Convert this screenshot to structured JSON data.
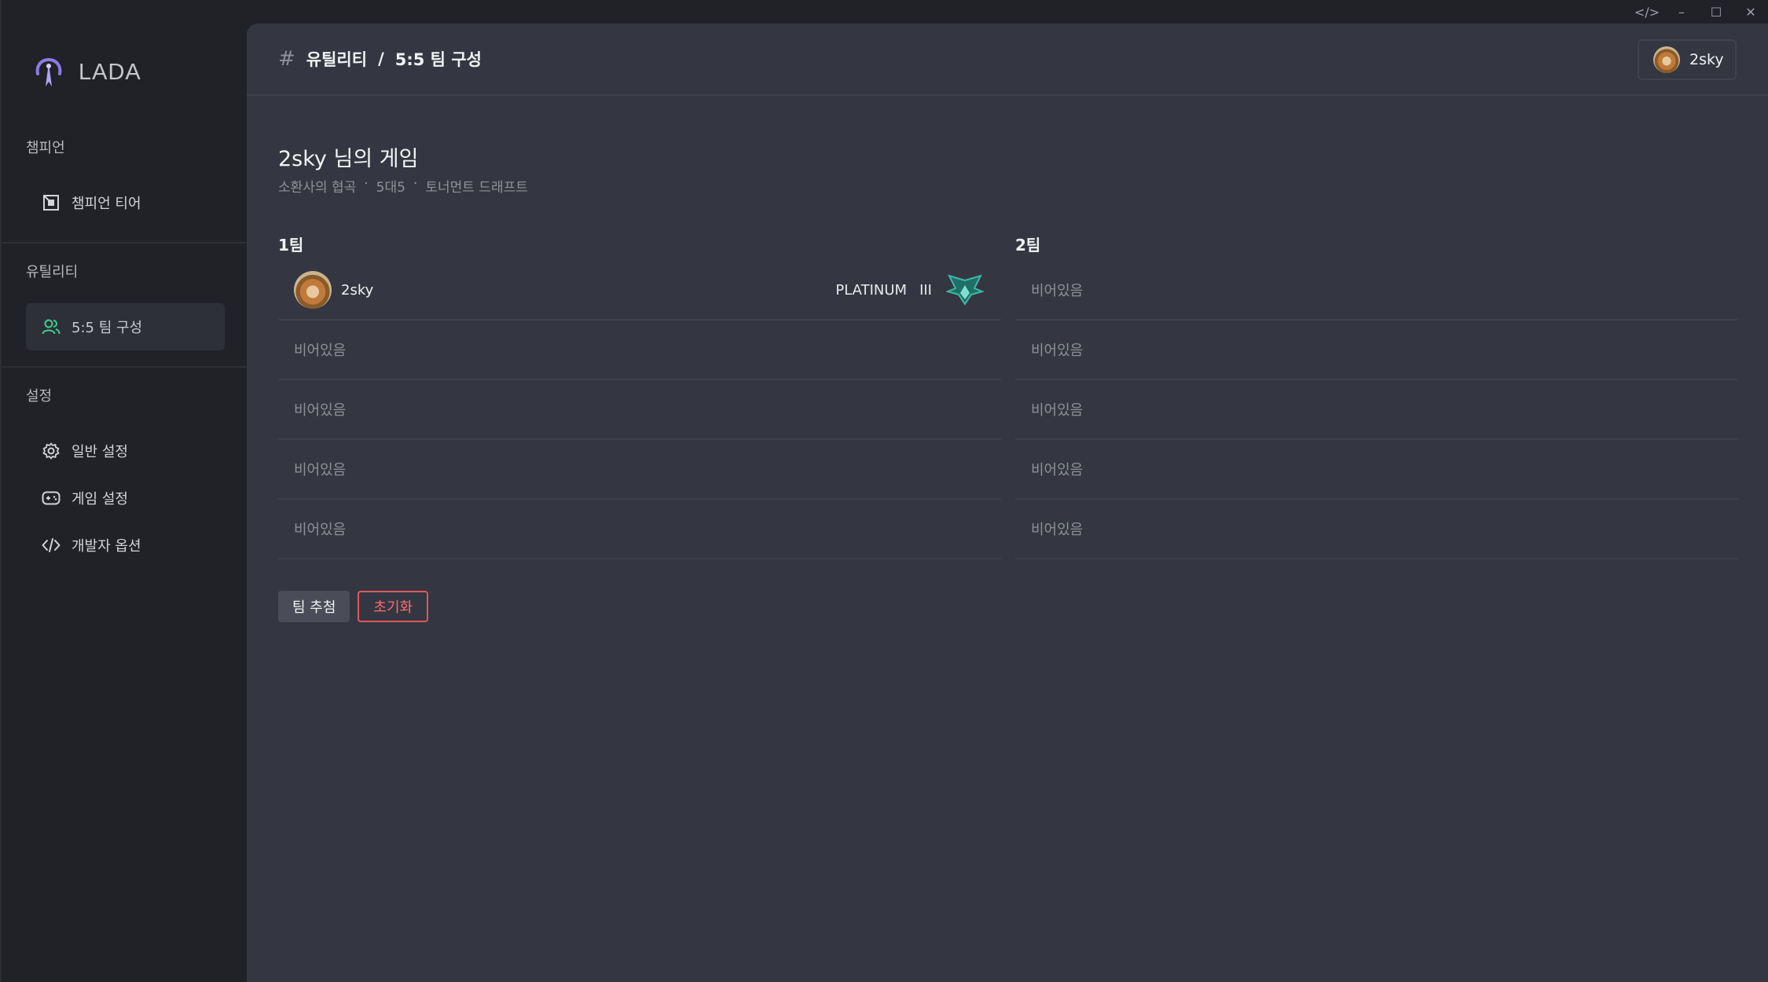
{
  "window": {
    "controls": [
      "</>",
      "–",
      "☐",
      "✕"
    ]
  },
  "sidebar": {
    "logo": "LADA",
    "sections": [
      {
        "title": "챔피언",
        "items": [
          {
            "label": "챔피언 티어",
            "icon": "tier-icon"
          }
        ]
      },
      {
        "title": "유틸리티",
        "items": [
          {
            "label": "5:5 팀 구성",
            "icon": "users-icon",
            "active": true
          }
        ]
      },
      {
        "title": "설정",
        "items": [
          {
            "label": "일반 설정",
            "icon": "gear-icon"
          },
          {
            "label": "게임 설정",
            "icon": "gamepad-icon"
          },
          {
            "label": "개발자 옵션",
            "icon": "code-icon"
          }
        ]
      }
    ]
  },
  "header": {
    "breadcrumb_section": "유틸리티",
    "breadcrumb_sep": "/",
    "breadcrumb_page": "5:5 팀 구성",
    "user": "2sky"
  },
  "game": {
    "title": "2sky 님의 게임",
    "map": "소환사의 협곡",
    "mode": "5대5",
    "draft": "토너먼트 드래프트",
    "dot": "·"
  },
  "teams": [
    {
      "label": "1팀",
      "slots": [
        {
          "name": "2sky",
          "tier": "PLATINUM",
          "division": "III",
          "accent": "#3fb8a8"
        },
        {
          "empty": "비어있음"
        },
        {
          "empty": "비어있음"
        },
        {
          "empty": "비어있음"
        },
        {
          "empty": "비어있음"
        }
      ]
    },
    {
      "label": "2팀",
      "slots": [
        {
          "empty": "비어있음"
        },
        {
          "empty": "비어있음"
        },
        {
          "empty": "비어있음"
        },
        {
          "empty": "비어있음"
        },
        {
          "empty": "비어있음"
        }
      ]
    }
  ],
  "actions": {
    "draw": "팀 추첨",
    "reset": "초기화"
  },
  "colors": {
    "accent_green": "#3ecf8e",
    "danger": "#e0575f",
    "logo": "#8f7ae8"
  }
}
